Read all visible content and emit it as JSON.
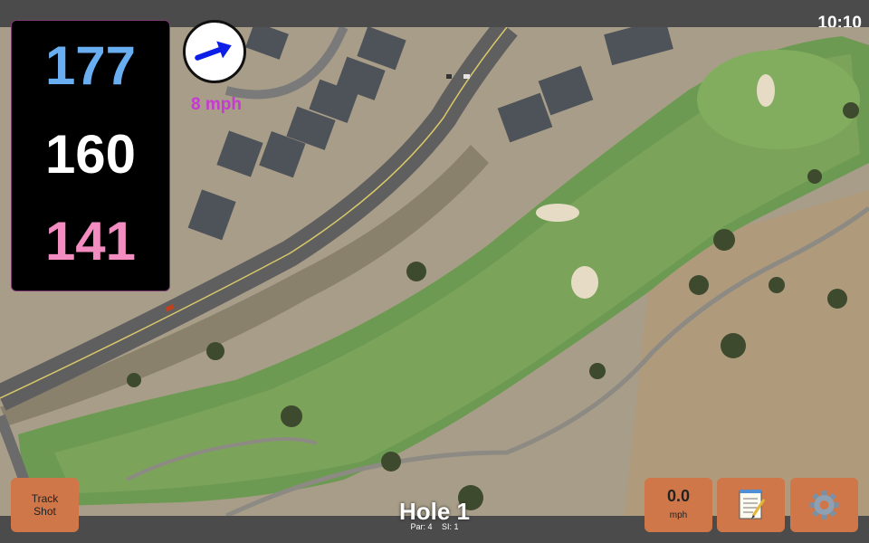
{
  "status_bar": {
    "time": "10:10"
  },
  "distances": {
    "back": "177",
    "center": "160",
    "front": "141",
    "colors": {
      "back": "#6aaef2",
      "center": "#ffffff",
      "front": "#f38cc0"
    }
  },
  "wind": {
    "speed_label": "8 mph",
    "direction_icon": "arrow-northeast-icon"
  },
  "hole": {
    "title": "Hole 1",
    "par": "Par: 4",
    "si": "SI: 1"
  },
  "buttons": {
    "track_shot": [
      "Track",
      "Shot"
    ],
    "speed": {
      "value": "0.0",
      "unit": "mph"
    },
    "notes_icon": "notepad-icon",
    "settings_icon": "gear-icon"
  },
  "colors": {
    "button_bg": "#cf7749",
    "wind_label": "#c73ad1",
    "bar_bg": "#4b4b4b"
  }
}
